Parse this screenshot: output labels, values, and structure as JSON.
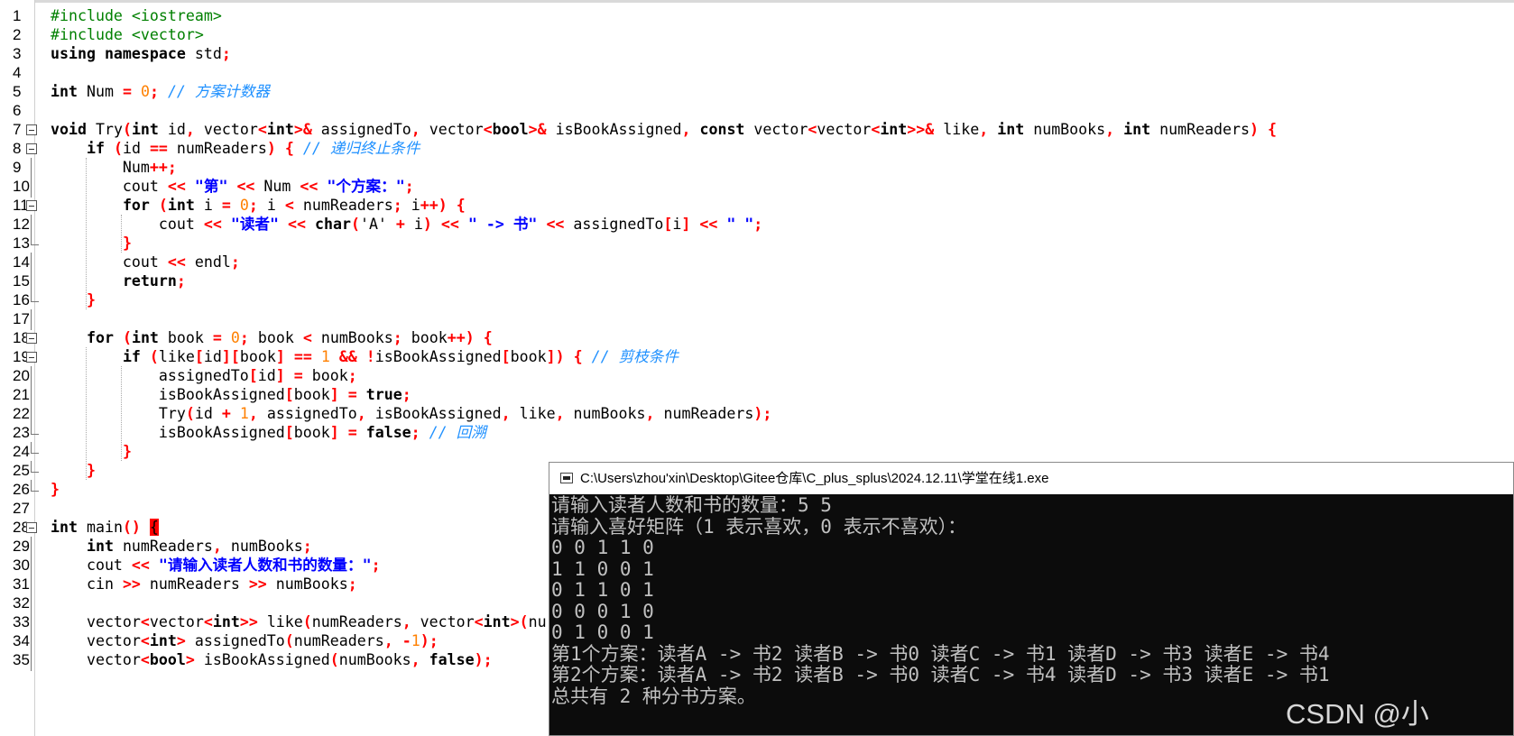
{
  "editor": {
    "lines": [
      {
        "n": "1",
        "code": "<span class=\"pp\">#include &lt;iostream&gt;</span>"
      },
      {
        "n": "2",
        "code": "<span class=\"pp\">#include &lt;vector&gt;</span>"
      },
      {
        "n": "3",
        "code": "<span class=\"kw\">using namespace</span> std<span class=\"op\">;</span>"
      },
      {
        "n": "4",
        "code": ""
      },
      {
        "n": "5",
        "code": "<span class=\"kw\">int</span> Num <span class=\"op\">=</span> <span class=\"num\">0</span><span class=\"op\">;</span> <span class=\"cm\">// 方案计数器</span>"
      },
      {
        "n": "6",
        "code": ""
      },
      {
        "n": "7",
        "code": "<span class=\"kw\">void</span> Try<span class=\"op\">(</span><span class=\"kw\">int</span> id<span class=\"op\">,</span> vector<span class=\"op\">&lt;</span><span class=\"kw\">int</span><span class=\"op\">&gt;&amp;</span> assignedTo<span class=\"op\">,</span> vector<span class=\"op\">&lt;</span><span class=\"kw\">bool</span><span class=\"op\">&gt;&amp;</span> isBookAssigned<span class=\"op\">,</span> <span class=\"kw\">const</span> vector<span class=\"op\">&lt;</span>vector<span class=\"op\">&lt;</span><span class=\"kw\">int</span><span class=\"op\">&gt;&gt;&amp;</span> like<span class=\"op\">,</span> <span class=\"kw\">int</span> numBooks<span class=\"op\">,</span> <span class=\"kw\">int</span> numReaders<span class=\"op\">)</span> <span class=\"op\">{</span>"
      },
      {
        "n": "8",
        "code": "    <span class=\"kw\">if</span> <span class=\"op\">(</span>id <span class=\"op\">==</span> numReaders<span class=\"op\">)</span> <span class=\"op\">{</span> <span class=\"cm\">// 递归终止条件</span>"
      },
      {
        "n": "9",
        "code": "        Num<span class=\"op\">++;</span>"
      },
      {
        "n": "10",
        "code": "        cout <span class=\"op\">&lt;&lt;</span> <span class=\"str\">\"第\"</span> <span class=\"op\">&lt;&lt;</span> Num <span class=\"op\">&lt;&lt;</span> <span class=\"str\">\"个方案：\"</span><span class=\"op\">;</span>"
      },
      {
        "n": "11",
        "code": "        <span class=\"kw\">for</span> <span class=\"op\">(</span><span class=\"kw\">int</span> i <span class=\"op\">=</span> <span class=\"num\">0</span><span class=\"op\">;</span> i <span class=\"op\">&lt;</span> numReaders<span class=\"op\">;</span> i<span class=\"op\">++)</span> <span class=\"op\">{</span>"
      },
      {
        "n": "12",
        "code": "            cout <span class=\"op\">&lt;&lt;</span> <span class=\"str\">\"读者\"</span> <span class=\"op\">&lt;&lt;</span> <span class=\"kw\">char</span><span class=\"op\">(</span>'A' <span class=\"op\">+</span> i<span class=\"op\">)</span> <span class=\"op\">&lt;&lt;</span> <span class=\"str\">\" -&gt; 书\"</span> <span class=\"op\">&lt;&lt;</span> assignedTo<span class=\"op\">[</span>i<span class=\"op\">]</span> <span class=\"op\">&lt;&lt;</span> <span class=\"str\">\" \"</span><span class=\"op\">;</span>"
      },
      {
        "n": "13",
        "code": "        <span class=\"op\">}</span>"
      },
      {
        "n": "14",
        "code": "        cout <span class=\"op\">&lt;&lt;</span> endl<span class=\"op\">;</span>"
      },
      {
        "n": "15",
        "code": "        <span class=\"kw\">return</span><span class=\"op\">;</span>"
      },
      {
        "n": "16",
        "code": "    <span class=\"op\">}</span>"
      },
      {
        "n": "17",
        "code": ""
      },
      {
        "n": "18",
        "code": "    <span class=\"kw\">for</span> <span class=\"op\">(</span><span class=\"kw\">int</span> book <span class=\"op\">=</span> <span class=\"num\">0</span><span class=\"op\">;</span> book <span class=\"op\">&lt;</span> numBooks<span class=\"op\">;</span> book<span class=\"op\">++)</span> <span class=\"op\">{</span>"
      },
      {
        "n": "19",
        "code": "        <span class=\"kw\">if</span> <span class=\"op\">(</span>like<span class=\"op\">[</span>id<span class=\"op\">][</span>book<span class=\"op\">]</span> <span class=\"op\">==</span> <span class=\"num\">1</span> <span class=\"op\">&amp;&amp;</span> <span class=\"op\">!</span>isBookAssigned<span class=\"op\">[</span>book<span class=\"op\">])</span> <span class=\"op\">{</span> <span class=\"cm\">// 剪枝条件</span>"
      },
      {
        "n": "20",
        "code": "            assignedTo<span class=\"op\">[</span>id<span class=\"op\">]</span> <span class=\"op\">=</span> book<span class=\"op\">;</span>"
      },
      {
        "n": "21",
        "code": "            isBookAssigned<span class=\"op\">[</span>book<span class=\"op\">]</span> <span class=\"op\">=</span> <span class=\"kw\">true</span><span class=\"op\">;</span>"
      },
      {
        "n": "22",
        "code": "            Try<span class=\"op\">(</span>id <span class=\"op\">+</span> <span class=\"num\">1</span><span class=\"op\">,</span> assignedTo<span class=\"op\">,</span> isBookAssigned<span class=\"op\">,</span> like<span class=\"op\">,</span> numBooks<span class=\"op\">,</span> numReaders<span class=\"op\">);</span>"
      },
      {
        "n": "23",
        "code": "            isBookAssigned<span class=\"op\">[</span>book<span class=\"op\">]</span> <span class=\"op\">=</span> <span class=\"kw\">false</span><span class=\"op\">;</span> <span class=\"cm\">// 回溯</span>"
      },
      {
        "n": "24",
        "code": "        <span class=\"op\">}</span>"
      },
      {
        "n": "25",
        "code": "    <span class=\"op\">}</span>"
      },
      {
        "n": "26",
        "code": "<span class=\"op\">}</span>"
      },
      {
        "n": "27",
        "code": ""
      },
      {
        "n": "28",
        "code": "<span class=\"kw\">int</span> main<span class=\"op\">()</span> <span class=\"brk\">{</span>"
      },
      {
        "n": "29",
        "code": "    <span class=\"kw\">int</span> numReaders<span class=\"op\">,</span> numBooks<span class=\"op\">;</span>"
      },
      {
        "n": "30",
        "code": "    cout <span class=\"op\">&lt;&lt;</span> <span class=\"str\">\"请输入读者人数和书的数量：\"</span><span class=\"op\">;</span>"
      },
      {
        "n": "31",
        "code": "    cin <span class=\"op\">&gt;&gt;</span> numReaders <span class=\"op\">&gt;&gt;</span> numBooks<span class=\"op\">;</span>"
      },
      {
        "n": "32",
        "code": ""
      },
      {
        "n": "33",
        "code": "    vector<span class=\"op\">&lt;</span>vector<span class=\"op\">&lt;</span><span class=\"kw\">int</span><span class=\"op\">&gt;&gt;</span> like<span class=\"op\">(</span>numReaders<span class=\"op\">,</span> vector<span class=\"op\">&lt;</span><span class=\"kw\">int</span><span class=\"op\">&gt;(</span>nu"
      },
      {
        "n": "34",
        "code": "    vector<span class=\"op\">&lt;</span><span class=\"kw\">int</span><span class=\"op\">&gt;</span> assignedTo<span class=\"op\">(</span>numReaders<span class=\"op\">,</span> <span class=\"op\">-</span><span class=\"num\">1</span><span class=\"op\">);</span>"
      },
      {
        "n": "35",
        "code": "    vector<span class=\"op\">&lt;</span><span class=\"kw\">bool</span><span class=\"op\">&gt;</span> isBookAssigned<span class=\"op\">(</span>numBooks<span class=\"op\">,</span> <span class=\"kw\">false</span><span class=\"op\">);</span>"
      }
    ],
    "folds": {
      "open": [
        "7",
        "8",
        "11",
        "18",
        "19",
        "28"
      ],
      "end": [
        "13",
        "16",
        "23",
        "24",
        "25",
        "26"
      ]
    }
  },
  "console": {
    "title": "C:\\Users\\zhou'xin\\Desktop\\Gitee仓库\\C_plus_splus\\2024.12.11\\学堂在线1.exe",
    "output": [
      "请输入读者人数和书的数量：5 5",
      "请输入喜好矩阵（1 表示喜欢，0 表示不喜欢）：",
      "0 0 1 1 0",
      "1 1 0 0 1",
      "0 1 1 0 1",
      "0 0 0 1 0",
      "0 1 0 0 1",
      "第1个方案：读者A -> 书2 读者B -> 书0 读者C -> 书1 读者D -> 书3 读者E -> 书4",
      "第2个方案：读者A -> 书2 读者B -> 书0 读者C -> 书4 读者D -> 书3 读者E -> 书1",
      "总共有 2 种分书方案。"
    ]
  },
  "watermark": "CSDN @小"
}
